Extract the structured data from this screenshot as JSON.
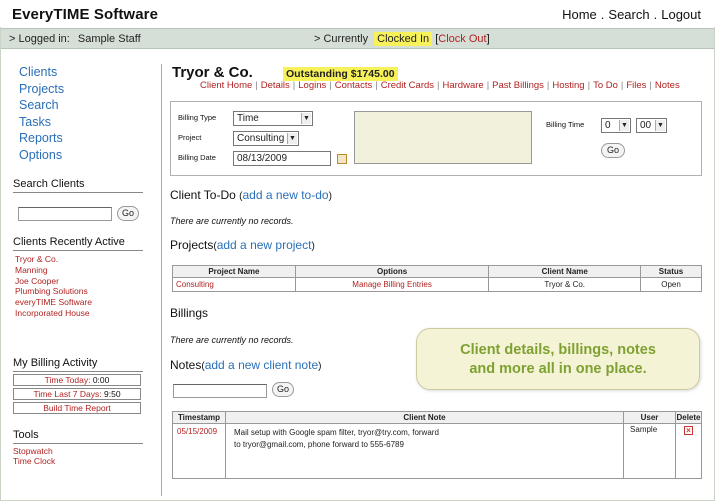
{
  "app": {
    "logo": "EveryTIME Software",
    "topnav": [
      "Home",
      "Search",
      "Logout"
    ]
  },
  "status": {
    "logged_in_label": "> Logged in:",
    "user": "Sample Staff",
    "currently_label": "> Currently",
    "clocked_state": "Clocked In",
    "clock_out": "Clock Out"
  },
  "sidebar": {
    "nav": [
      "Clients",
      "Projects",
      "Search",
      "Tasks",
      "Reports",
      "Options"
    ],
    "search_heading": "Search Clients",
    "go_label": "Go",
    "recent_heading": "Clients Recently Active",
    "recent_clients": [
      "Tryor & Co.",
      "Manning",
      "Joe Cooper",
      "Plumbing Solutions",
      "everyTIME Software",
      "Incorporated House"
    ],
    "billing_heading": "My Billing Activity",
    "time_today_label": "Time Today:",
    "time_today_value": "0:00",
    "time_7_label": "Time Last 7 Days:",
    "time_7_value": "9:50",
    "build_report": "Build Time Report",
    "tools_heading": "Tools",
    "tools": [
      "Stopwatch",
      "Time Clock"
    ]
  },
  "client": {
    "name": "Tryor & Co.",
    "outstanding": "Outstanding $1745.00",
    "subnav": [
      "Client Home",
      "Details",
      "Logins",
      "Contacts",
      "Credit Cards",
      "Hardware",
      "Past Billings",
      "Hosting",
      "To Do",
      "Files",
      "Notes"
    ]
  },
  "billing_form": {
    "billing_type_label": "Billing Type",
    "billing_type_value": "Time",
    "project_label": "Project",
    "project_value": "Consulting",
    "billing_date_label": "Billing Date",
    "billing_date_value": "08/13/2009",
    "billing_time_label": "Billing Time",
    "hours_value": "0",
    "minutes_value": "00",
    "go_label": "Go"
  },
  "todo": {
    "title": "Client To-Do",
    "add_link": "add a new to-do",
    "empty": "There are currently no records."
  },
  "projects": {
    "title": "Projects",
    "add_link": "add a new project",
    "columns": [
      "Project Name",
      "Options",
      "Client Name",
      "Status"
    ],
    "rows": [
      {
        "name": "Consulting",
        "options": "Manage Billing Entries",
        "client": "Tryor & Co.",
        "status": "Open"
      }
    ]
  },
  "billings": {
    "title": "Billings",
    "empty": "There are currently no records."
  },
  "notes": {
    "title": "Notes",
    "add_link": "add a new client note",
    "go_label": "Go",
    "columns": [
      "Timestamp",
      "Client Note",
      "User",
      "Delete"
    ],
    "rows": [
      {
        "timestamp": "05/15/2009",
        "note_line1": "Mail setup with Google spam filter, tryor@try.com, forward",
        "note_line2": "to tryor@gmail.com, phone forward to 555-6789",
        "user": "Sample"
      }
    ]
  },
  "callout": {
    "line1": "Client details, billings, notes",
    "line2": "and more all in one place."
  },
  "colors": {
    "link_blue": "#2a6fb8",
    "link_red": "#b22222",
    "highlight_yellow": "#f7f25a",
    "statusbar_bg": "#d6dfd7",
    "callout_green": "#7ea131"
  }
}
